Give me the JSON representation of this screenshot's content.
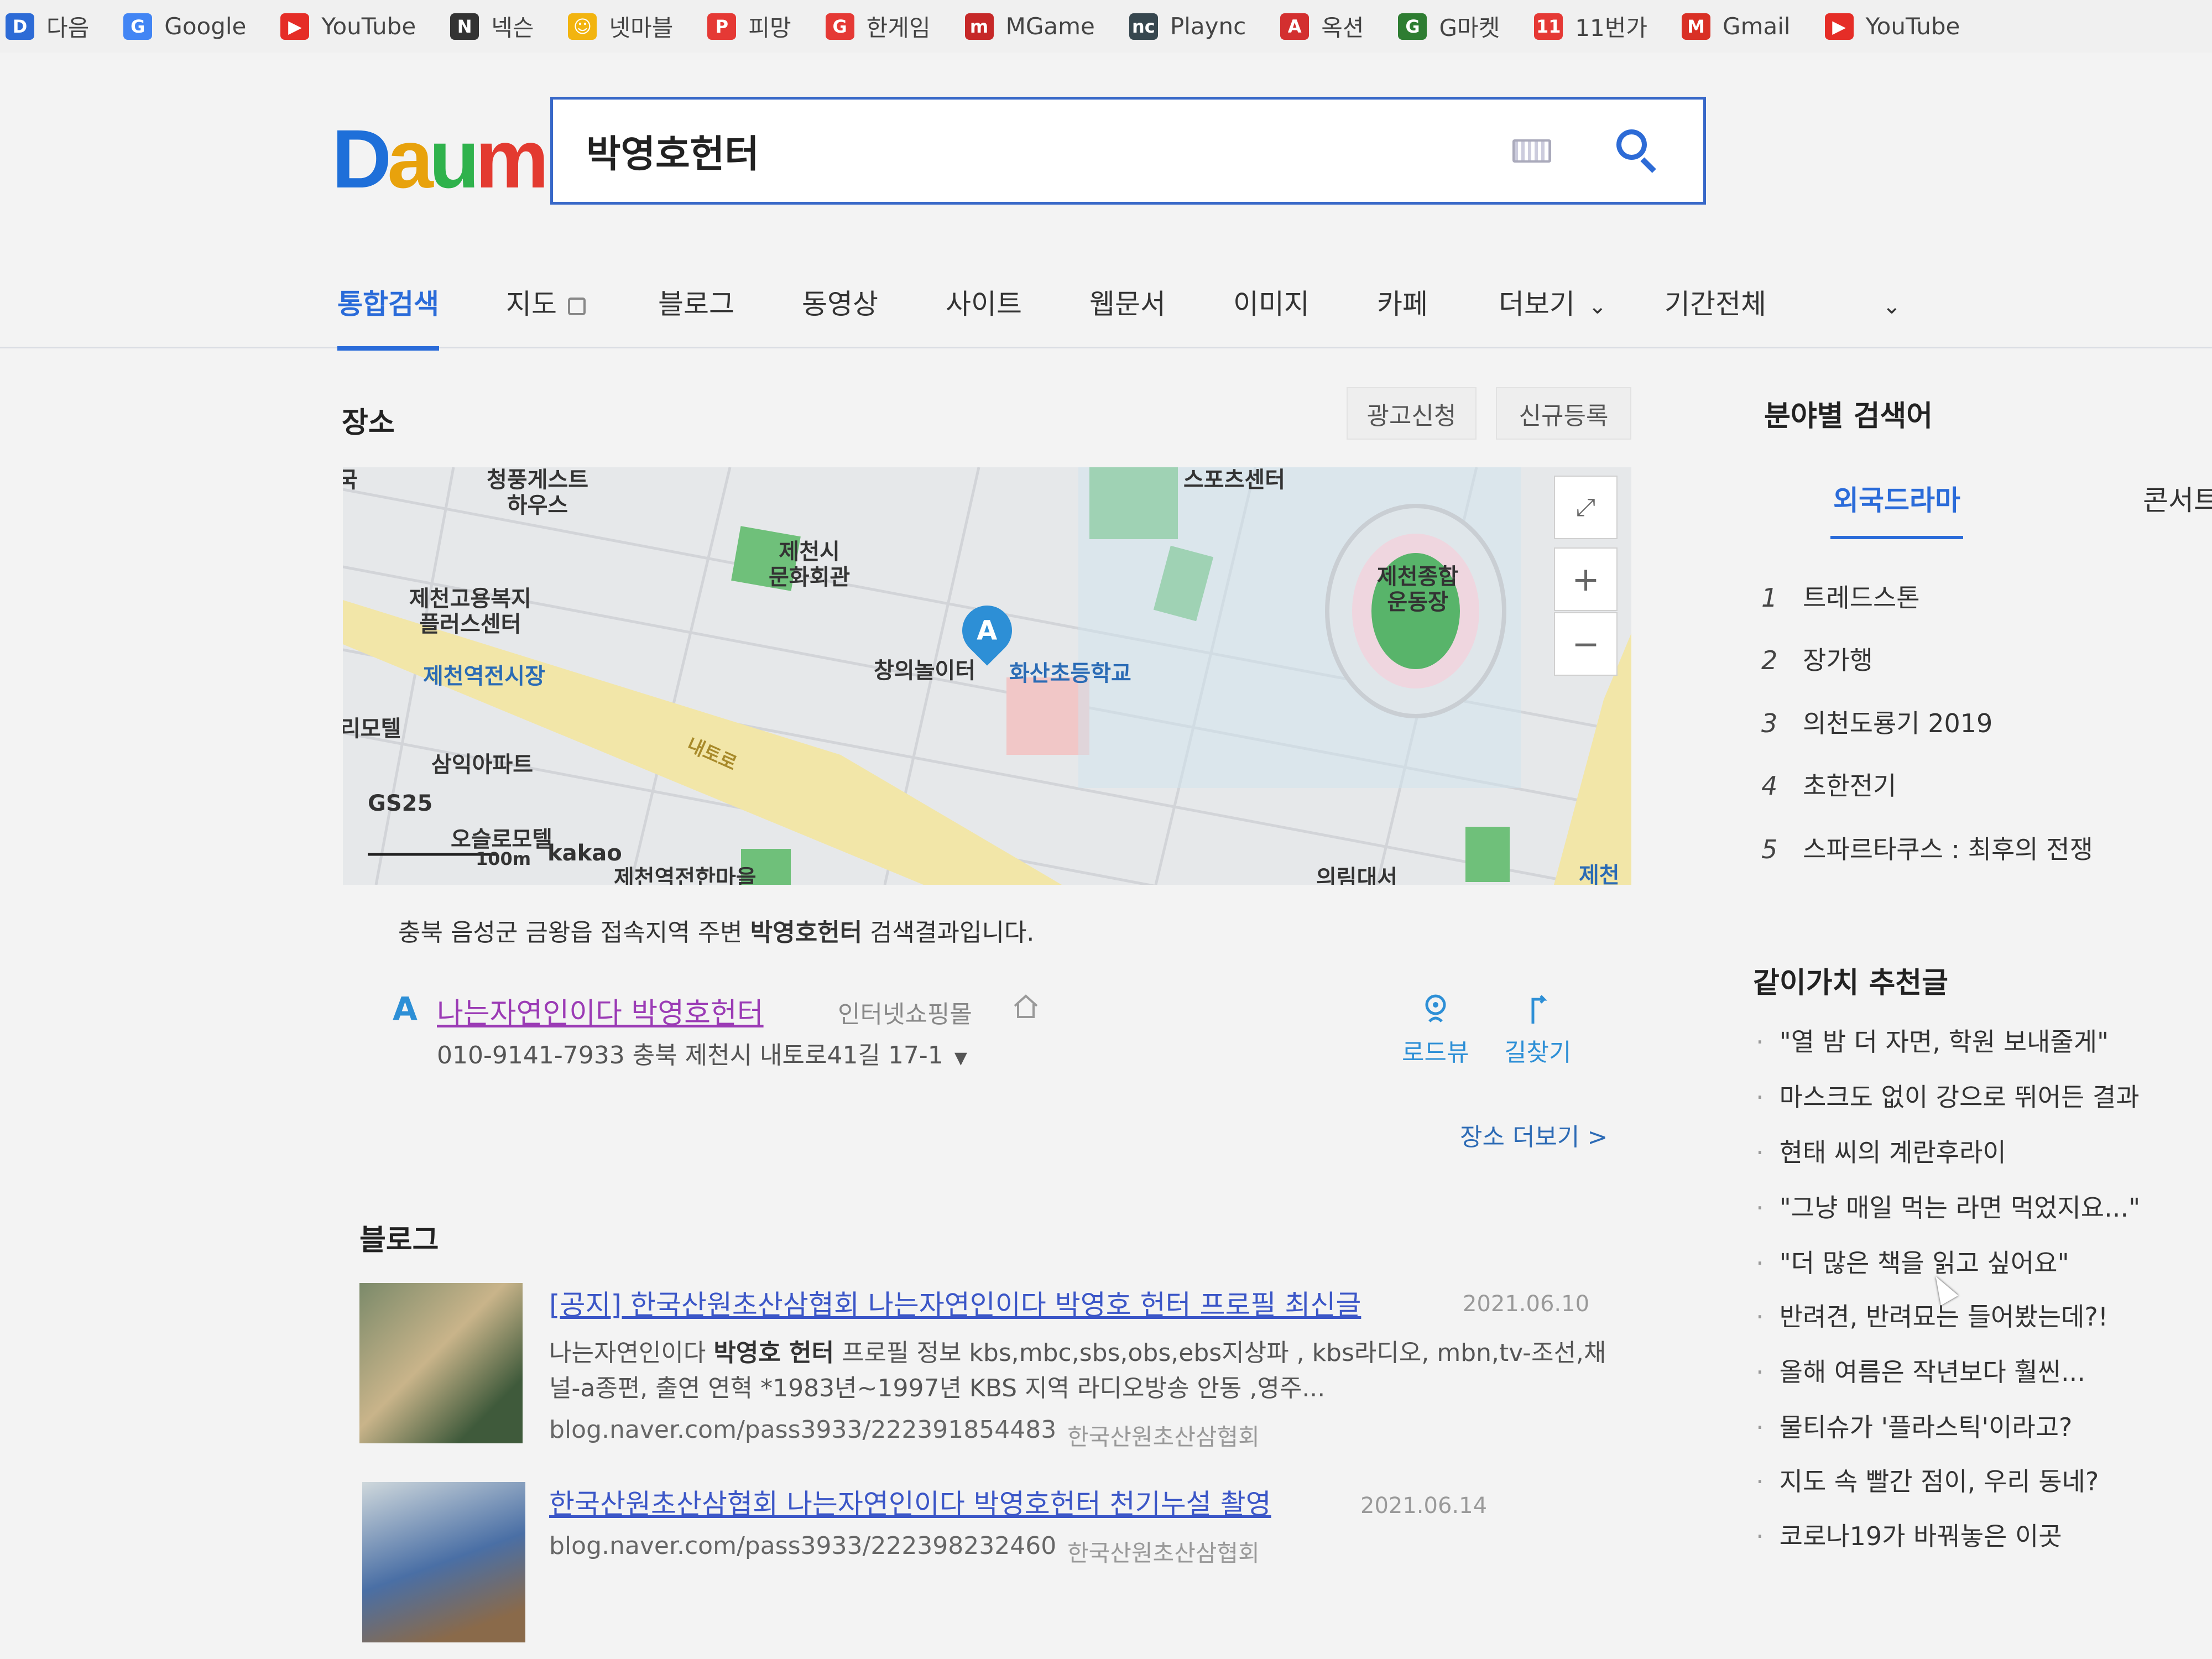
{
  "bookmarks": [
    {
      "label": "다음",
      "icon": "daum-icon",
      "color": "#2d6bd6",
      "glyph": "D"
    },
    {
      "label": "Google",
      "icon": "google-icon",
      "color": "#4285f4",
      "glyph": "G"
    },
    {
      "label": "YouTube",
      "icon": "youtube-icon",
      "color": "#e52d27",
      "glyph": "▶"
    },
    {
      "label": "넥슨",
      "icon": "nexon-icon",
      "color": "#333333",
      "glyph": "N"
    },
    {
      "label": "넷마블",
      "icon": "netmarble-icon",
      "color": "#f2b40f",
      "glyph": "☺"
    },
    {
      "label": "피망",
      "icon": "pmang-icon",
      "color": "#e53935",
      "glyph": "P"
    },
    {
      "label": "한게임",
      "icon": "hangame-icon",
      "color": "#e53935",
      "glyph": "G"
    },
    {
      "label": "MGame",
      "icon": "mgame-icon",
      "color": "#c62828",
      "glyph": "m"
    },
    {
      "label": "Plaync",
      "icon": "plaync-icon",
      "color": "#37474f",
      "glyph": "nc"
    },
    {
      "label": "옥션",
      "icon": "auction-icon",
      "color": "#d32f2f",
      "glyph": "A"
    },
    {
      "label": "G마켓",
      "icon": "gmarket-icon",
      "color": "#2e7d32",
      "glyph": "G"
    },
    {
      "label": "11번가",
      "icon": "11st-icon",
      "color": "#e53935",
      "glyph": "11"
    },
    {
      "label": "Gmail",
      "icon": "gmail-icon",
      "color": "#d93025",
      "glyph": "M"
    },
    {
      "label": "YouTube",
      "icon": "youtube-icon",
      "color": "#e52d27",
      "glyph": "▶"
    }
  ],
  "search": {
    "query": "박영호헌터"
  },
  "tabs": [
    {
      "label": "통합검색",
      "active": true
    },
    {
      "label": "지도"
    },
    {
      "label": "블로그"
    },
    {
      "label": "동영상"
    },
    {
      "label": "사이트"
    },
    {
      "label": "웹문서"
    },
    {
      "label": "이미지"
    },
    {
      "label": "카페"
    },
    {
      "label": "더보기"
    },
    {
      "label": "기간전체"
    }
  ],
  "place": {
    "title": "장소",
    "ad_button": "광고신청",
    "register_button": "신규등록",
    "map": {
      "labels": [
        "국",
        "청풍게스트\n하우스",
        "제천시\n문화회관",
        "스포츠센터",
        "제천고용복지\n플러스센터",
        "제천역전시장",
        "창의놀이터",
        "화산초등학교",
        "제천종합\n운동장",
        "리모텔",
        "삼익아파트",
        "GS25",
        "오슬로모텔",
        "내토로",
        "100m",
        "kakao",
        "제천역전한마을",
        "의림대서",
        "제천"
      ],
      "marker": "A"
    },
    "notice_prefix": "충북 음성군 금왕읍 접속지역 주변 ",
    "notice_keyword": "박영호헌터",
    "notice_suffix": " 검색결과입니다.",
    "result": {
      "marker": "A",
      "name": "나는자연인이다 박영호헌터",
      "category": "인터넷쇼핑몰",
      "address": "010-9141-7933 충북 제천시 내토로41길 17-1",
      "roadview": "로드뷰",
      "directions": "길찾기"
    },
    "more": "장소 더보기 >"
  },
  "blog": {
    "title": "블로그",
    "items": [
      {
        "title": "[공지] 한국산원초산삼협회 나는자연인이다 박영호 헌터 프로필 최신글",
        "date": "2021.06.10",
        "desc_prefix": "나는자연인이다 ",
        "desc_keyword": "박영호 헌터",
        "desc_suffix": " 프로필 정보 kbs,mbc,sbs,obs,ebs지상파 , kbs라디오, mbn,tv-조선,채널-a종편, 출연 연혁 *1983년~1997년 KBS 지역 라디오방송 안동 ,영주...",
        "url": "blog.naver.com/pass3933/222391854483",
        "source": "한국산원초산삼협회"
      },
      {
        "title": "한국산원초산삼협회 나는자연인이다 박영호헌터 천기누설 촬영",
        "date": "2021.06.14",
        "url": "blog.naver.com/pass3933/222398232460",
        "source": "한국산원초산삼협회"
      }
    ]
  },
  "sidebar": {
    "title": "분야별 검색어",
    "tabs": [
      "외국드라마",
      "콘서트"
    ],
    "ranking": [
      {
        "n": "1",
        "label": "트레드스톤"
      },
      {
        "n": "2",
        "label": "장가행"
      },
      {
        "n": "3",
        "label": "의천도룡기 2019"
      },
      {
        "n": "4",
        "label": "초한전기"
      },
      {
        "n": "5",
        "label": "스파르타쿠스 : 최후의 전쟁"
      }
    ],
    "rec_title": "같이가치 추천글",
    "recommendations": [
      "\"열 밤 더 자면, 학원 보내줄게\"",
      "마스크도 없이 강으로 뛰어든 결과",
      "현태 씨의 계란후라이",
      "\"그냥 매일 먹는 라면 먹었지요...\"",
      "\"더 많은 책을 읽고 싶어요\"",
      "반려견, 반려묘는 들어봤는데?!",
      "올해 여름은 작년보다 훨씬...",
      "물티슈가 '플라스틱'이라고?",
      "지도 속 빨간 점이, 우리 동네?",
      "코로나19가 바꿔놓은 이곳"
    ]
  },
  "colors": {
    "accent": "#2a6bd9",
    "search_border": "#3868c8",
    "visited_link": "#9b3bb5",
    "link": "#3b56c7"
  }
}
